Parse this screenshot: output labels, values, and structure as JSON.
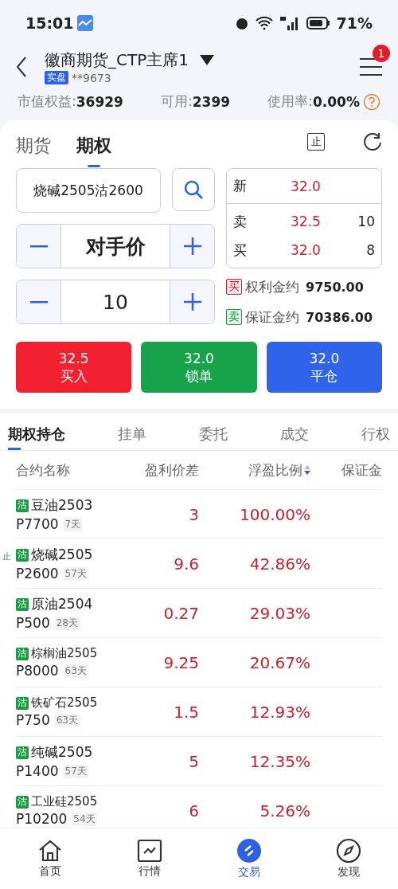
{
  "status_bar": {
    "time": "15:01",
    "battery": "71%"
  },
  "header": {
    "title": "徽商期货_CTP主席1",
    "account_tag": "实盘",
    "account": "**9673",
    "badge": "1"
  },
  "summary": [
    {
      "label": "市值权益:",
      "value": "36929"
    },
    {
      "label": "可用:",
      "value": "2399"
    },
    {
      "label": "使用率:",
      "value": "0.00%"
    }
  ],
  "mode_tabs": [
    {
      "label": "期货",
      "selected": false
    },
    {
      "label": "期权",
      "selected": true
    }
  ],
  "toolbar": {
    "stop_label": "止"
  },
  "order": {
    "contract": "烧碱2505沽2600",
    "price_mode": "对手价",
    "quantity": "10"
  },
  "quote": {
    "last_label": "新",
    "last": "32.0",
    "rows": [
      {
        "label": "卖",
        "price": "32.5",
        "volume": "10"
      },
      {
        "label": "买",
        "price": "32.0",
        "volume": "8"
      }
    ]
  },
  "estimates": [
    {
      "tag": "买",
      "kind": "buy",
      "label": "权利金约",
      "value": "9750.00"
    },
    {
      "tag": "卖",
      "kind": "sell",
      "label": "保证金约",
      "value": "70386.00"
    }
  ],
  "actions": [
    {
      "price": "32.5",
      "label": "买入",
      "kind": "buy"
    },
    {
      "price": "32.0",
      "label": "锁单",
      "kind": "lock"
    },
    {
      "price": "32.0",
      "label": "平仓",
      "kind": "close"
    }
  ],
  "position_tabs": [
    {
      "label": "期权持仓",
      "selected": true
    },
    {
      "label": "挂单",
      "selected": false
    },
    {
      "label": "委托",
      "selected": false
    },
    {
      "label": "成交",
      "selected": false
    },
    {
      "label": "行权",
      "selected": false
    }
  ],
  "columns": [
    "合约名称",
    "盈利价差",
    "浮盈比例",
    "保证金"
  ],
  "rows": [
    {
      "tag": "沽",
      "name": "豆油2503",
      "strike": "P7700",
      "days": "7天",
      "profit": "3",
      "ratio": "100.00%"
    },
    {
      "tag": "沽",
      "name": "烧碱2505",
      "strike": "P2600",
      "days": "57天",
      "profit": "9.6",
      "ratio": "42.86%",
      "stop_label": "止"
    },
    {
      "tag": "沽",
      "name": "原油2504",
      "strike": "P500",
      "days": "28天",
      "profit": "0.27",
      "ratio": "29.03%"
    },
    {
      "tag": "沽",
      "name": "棕榈油2505",
      "strike": "P8000",
      "days": "63天",
      "profit": "9.25",
      "ratio": "20.67%"
    },
    {
      "tag": "沽",
      "name": "铁矿石2505",
      "strike": "P750",
      "days": "63天",
      "profit": "1.5",
      "ratio": "12.93%"
    },
    {
      "tag": "沽",
      "name": "纯碱2505",
      "strike": "P1400",
      "days": "57天",
      "profit": "5",
      "ratio": "12.35%"
    },
    {
      "tag": "沽",
      "name": "工业硅2505",
      "strike": "P10200",
      "days": "54天",
      "profit": "6",
      "ratio": "5.26%"
    }
  ],
  "nav": [
    {
      "label": "首页",
      "kind": "home",
      "selected": false
    },
    {
      "label": "行情",
      "kind": "chart",
      "selected": false
    },
    {
      "label": "交易",
      "kind": "trade",
      "selected": true
    },
    {
      "label": "发现",
      "kind": "compass",
      "selected": false
    }
  ]
}
